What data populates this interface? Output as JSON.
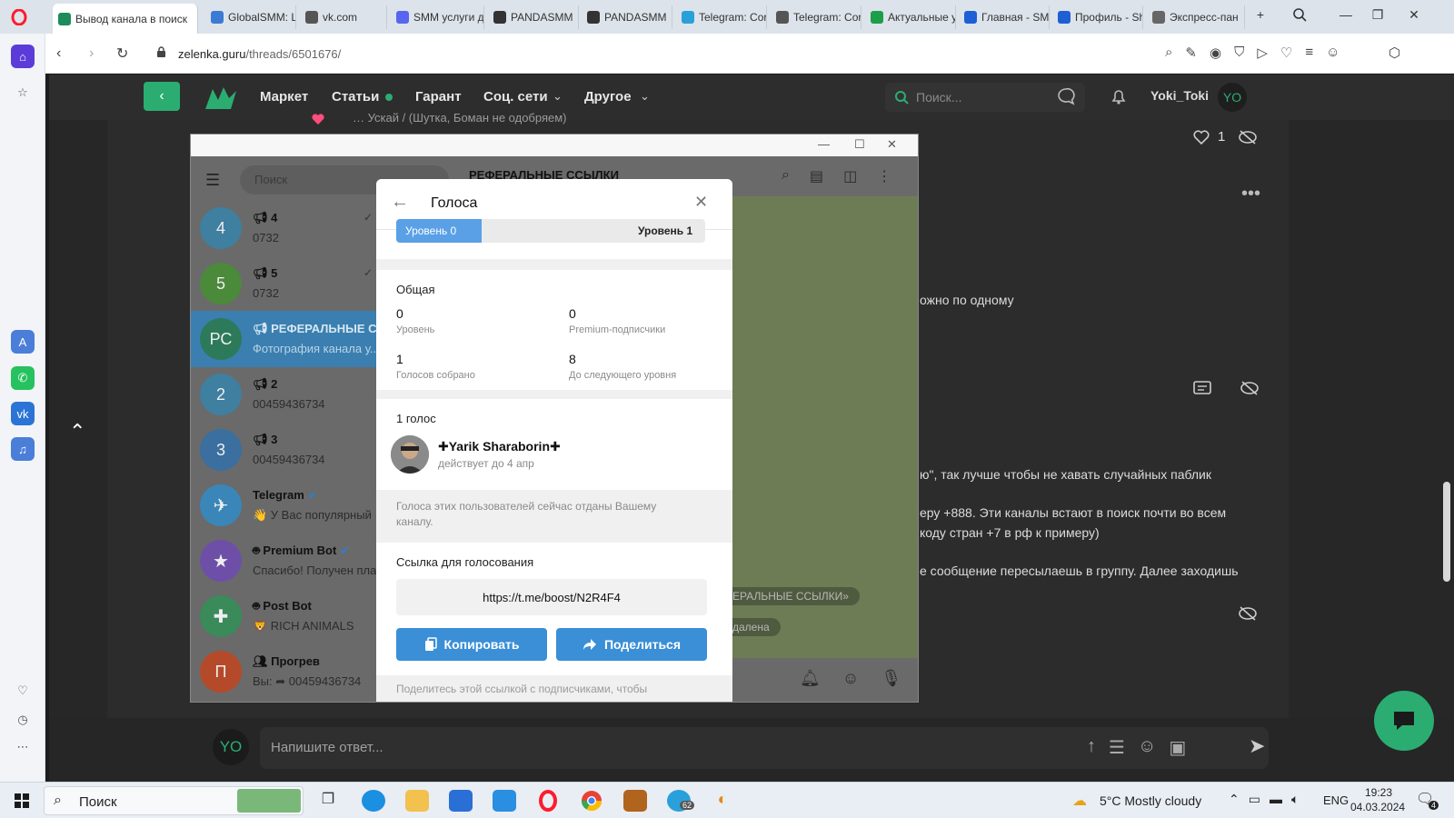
{
  "browser": {
    "tabs": [
      {
        "label": "Вывод канала в поиск",
        "icon": "zelenka-icon",
        "color": "#1f8a5a"
      },
      {
        "label": "GlobalSMM: L",
        "icon": "globe-icon",
        "color": "#3b7bd5"
      },
      {
        "label": "vk.com",
        "icon": "globe-icon",
        "color": "#555555"
      },
      {
        "label": "SMM услуги д",
        "icon": "discord-icon",
        "color": "#5865f2"
      },
      {
        "label": "PANDASMM",
        "icon": "panda-icon",
        "color": "#333333"
      },
      {
        "label": "PANDASMM",
        "icon": "panda-icon",
        "color": "#333333"
      },
      {
        "label": "Telegram: Cor",
        "icon": "telegram-icon",
        "color": "#2aa0da"
      },
      {
        "label": "Telegram: Cor",
        "icon": "globe-icon",
        "color": "#555555"
      },
      {
        "label": "Актуальные у",
        "icon": "sheets-icon",
        "color": "#1e9e4a"
      },
      {
        "label": "Главная - SMI",
        "icon": "s-icon",
        "color": "#1e5fd6"
      },
      {
        "label": "Профиль - Sh",
        "icon": "s-icon",
        "color": "#1e5fd6"
      },
      {
        "label": "Экспресс-пан",
        "icon": "grid-icon",
        "color": "#666666"
      }
    ],
    "new_tab": "+",
    "url_host": "zelenka.guru",
    "url_path": "/threads/6501676/"
  },
  "forum": {
    "nav": [
      "Маркет",
      "Статьи",
      "Гарант",
      "Соц. сети",
      "Другое"
    ],
    "search_placeholder": "Поиск...",
    "username": "Yoki_Toki",
    "avatar": "YO",
    "like_count": "1",
    "post_top_line": "… Ускай / (Шутка, Боман не одобряем)",
    "post_lines": [
      "ожно по одному",
      "ю\", так лучше чтобы не хавать случайных паблик",
      "еру +888. Эти каналы встают в поиск почти во всем",
      "коду стран +7 в рф к примеру)",
      "е сообщение пересылаешь в группу. Далее заходишь"
    ],
    "reply_placeholder": "Напишите ответ...",
    "accent": "#2bad72"
  },
  "telegram": {
    "search_placeholder": "Поиск",
    "chat_header": "РЕФЕРАЛЬНЫЕ ССЫЛКИ",
    "chats": [
      {
        "avatar": "4",
        "name": "4",
        "preview": "0732",
        "color": "#3f7fa0"
      },
      {
        "avatar": "5",
        "name": "5",
        "preview": "0732",
        "color": "#4a8a3a"
      },
      {
        "avatar": "РС",
        "name": "РЕФЕРАЛЬНЫЕ СС...",
        "preview": "Фотография канала у...",
        "color": "#2c7a5a"
      },
      {
        "avatar": "2",
        "name": "2",
        "preview": "00459436734",
        "color": "#3f7fa0"
      },
      {
        "avatar": "3",
        "name": "3",
        "preview": "00459436734",
        "color": "#3a6fa0"
      },
      {
        "avatar": "",
        "name": "Telegram",
        "preview": "👋 У Вас популярный",
        "color": "#3a86b8"
      },
      {
        "avatar": "",
        "name": "Premium Bot",
        "preview": "Спасибо! Получен пла",
        "color": "#6e4fa8"
      },
      {
        "avatar": "",
        "name": "Post Bot",
        "preview": "🦁 RICH ANIMALS",
        "color": "#3a8a5a"
      },
      {
        "avatar": "П",
        "name": "Прогрев",
        "preview": "Вы: ➦ 00459436734",
        "color": "#b54a2a"
      }
    ],
    "chat_bubbles": [
      "ЕРАЛЬНЫЕ ССЫЛКИ»",
      "далена"
    ]
  },
  "dialog": {
    "title": "Голоса",
    "level_current": "Уровень 0",
    "level_next": "Уровень 1",
    "section_general": "Общая",
    "stats": [
      {
        "value": "0",
        "label": "Уровень"
      },
      {
        "value": "0",
        "label": "Premium-подписчики"
      },
      {
        "value": "1",
        "label": "Голосов собрано"
      },
      {
        "value": "8",
        "label": "До следующего уровня"
      }
    ],
    "votes_title": "1 голос",
    "voter_name": "✚Yarik Sharaborin✚",
    "voter_status": "действует до 4 апр",
    "note": "Голоса этих пользователей сейчас отданы Вашему каналу.",
    "link_title": "Ссылка для голосования",
    "link": "https://t.me/boost/N2R4F4",
    "copy_label": "Копировать",
    "share_label": "Поделиться",
    "footer_text": "Поделитесь этой ссылкой с подписчиками, чтобы",
    "accent": "#3a8fd6"
  },
  "taskbar": {
    "search_label": "Поиск",
    "weather": "5°C Mostly cloudy",
    "lang": "ENG",
    "time": "19:23",
    "date": "04.03.2024",
    "tg_badge": "62",
    "notif_badge": "4"
  }
}
